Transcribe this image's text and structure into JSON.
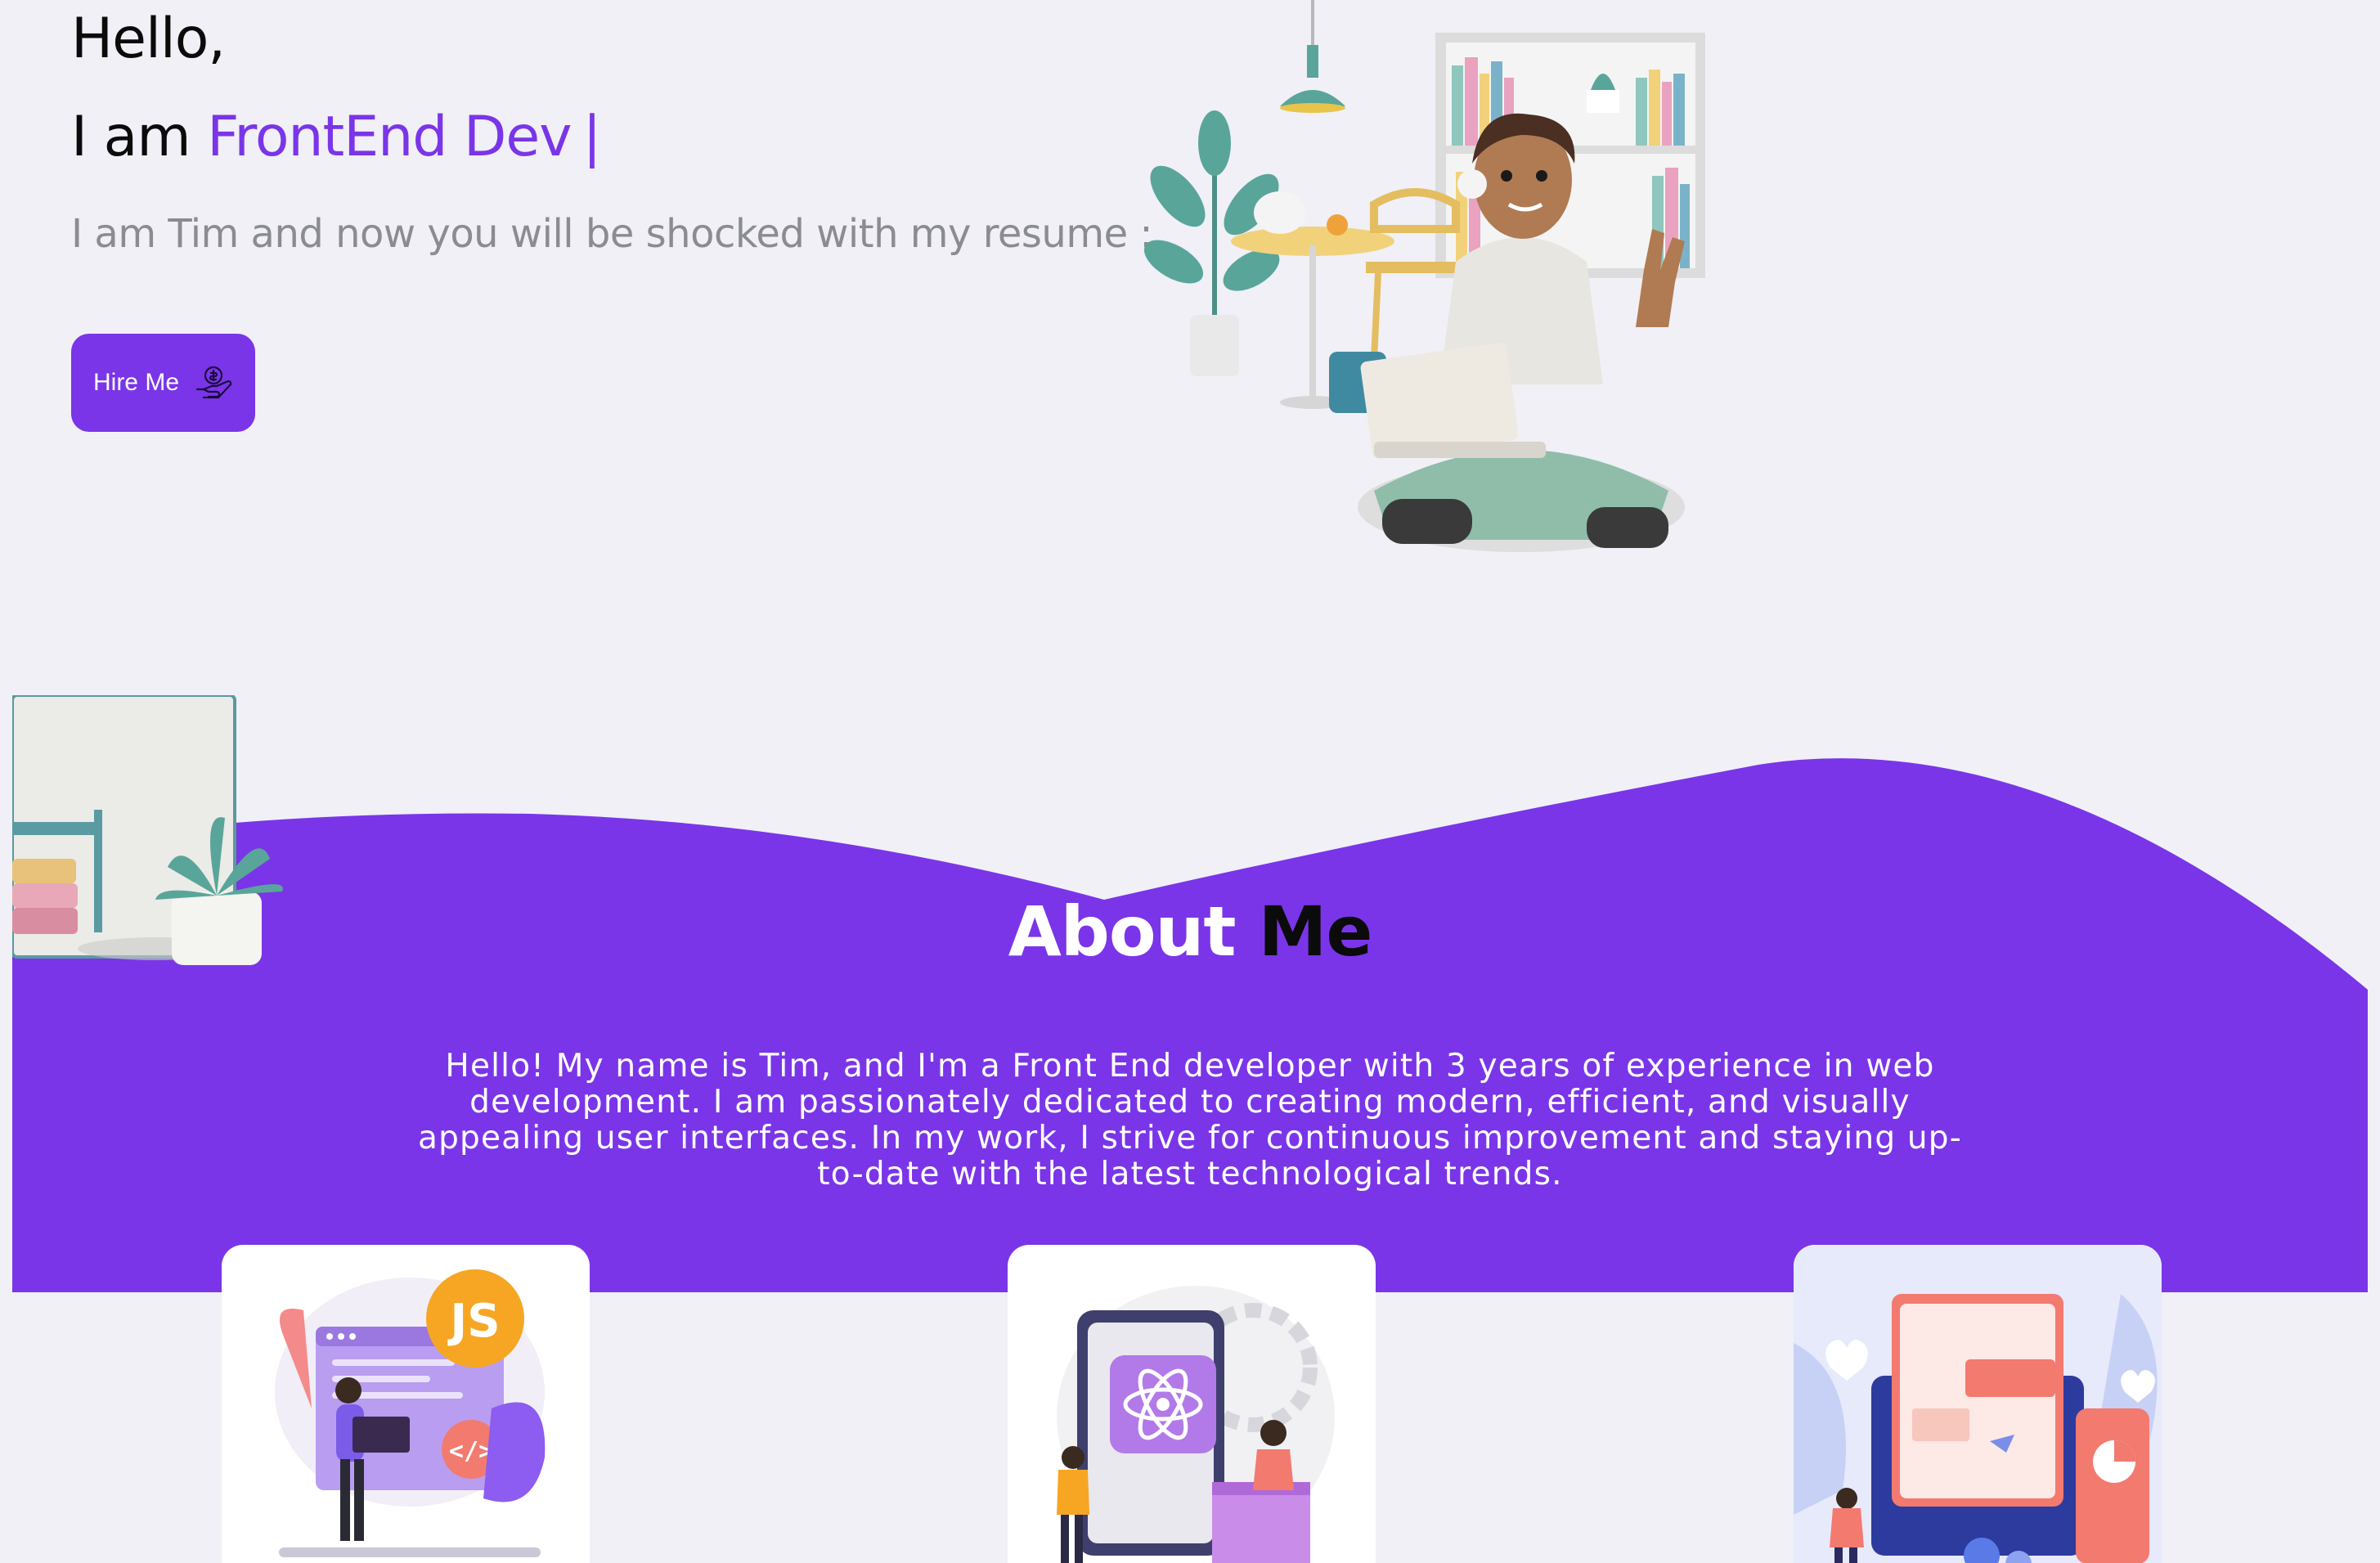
{
  "hero": {
    "greeting": "Hello,",
    "role_prefix": "I am ",
    "role_accent": "FrontEnd Dev",
    "caret": "|",
    "intro": "I am Tim and now you will be shocked with my resume :",
    "hire_button_label": "Hire Me",
    "hire_icon": "hand-coin-icon"
  },
  "about": {
    "title_part1": "About",
    "title_part2": "Me",
    "text": "Hello! My name is Tim, and I'm a Front End developer with 3 years of experience in web development. I am passionately dedicated to creating modern, efficient, and visually appealing user interfaces. In my work, I strive for continuous improvement and staying up-to-date with the latest technological trends."
  },
  "cards": [
    {
      "illustration": "javascript-developer-illustration",
      "badge1": "JS",
      "badge2": "</>"
    },
    {
      "illustration": "react-mobile-illustration"
    },
    {
      "illustration": "web-design-illustration"
    }
  ],
  "colors": {
    "accent": "#7a35e8",
    "background": "#f0f0f6",
    "muted_text": "#8b8b94"
  }
}
